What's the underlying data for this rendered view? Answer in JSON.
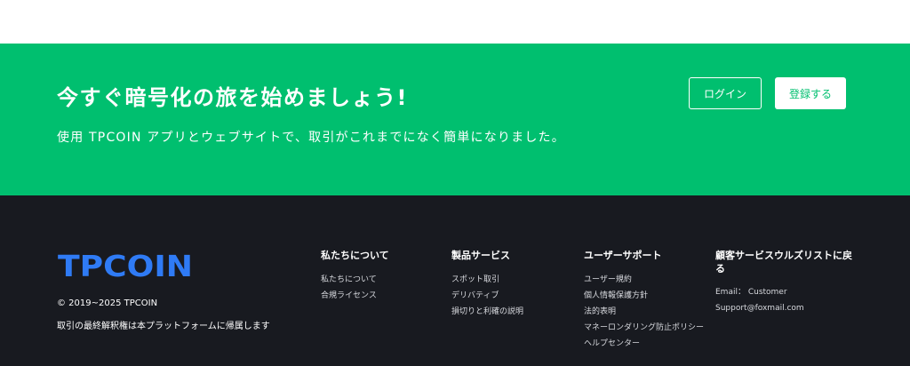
{
  "cta": {
    "title": "今すぐ暗号化の旅を始めましょう!",
    "description": "使用 TPCOIN アプリとウェブサイトで、取引がこれまでになく簡単になりました。",
    "login_label": "ログイン",
    "register_label": "登録する"
  },
  "footer": {
    "logo_text": "TPCOIN",
    "copyright": "© 2019~2025 TPCOIN",
    "rights": "取引の最終解釈権は本プラットフォームに帰属します",
    "columns": [
      {
        "title": "私たちについて",
        "links": [
          "私たちについて",
          "合規ライセンス"
        ]
      },
      {
        "title": "製品サービス",
        "links": [
          "スポット取引",
          "デリバティブ",
          "損切りと利確の説明"
        ]
      },
      {
        "title": "ユーザーサポート",
        "links": [
          "ユーザー規約",
          "個人情報保護方針",
          "法的表明",
          "マネーロンダリング防止ポリシー",
          "ヘルプセンター"
        ]
      },
      {
        "title": "顧客サービスウルズリストに戻る",
        "links": [
          "Email： Customer",
          "Support@foxmail.com"
        ]
      }
    ]
  },
  "colors": {
    "accent_green": "#00bf6f",
    "footer_bg": "#181a20",
    "logo_blue": "#2f7bf5"
  }
}
